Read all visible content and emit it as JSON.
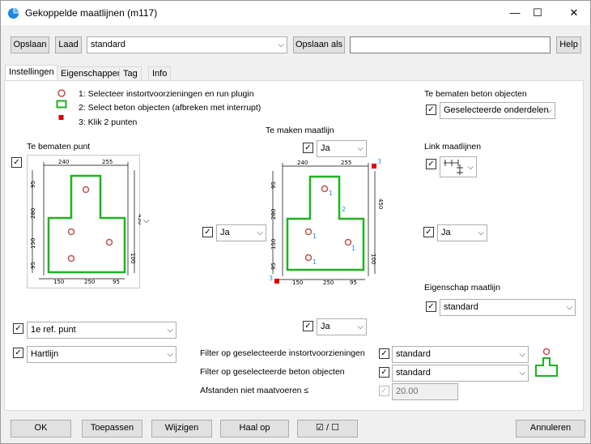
{
  "window": {
    "title": "Gekoppelde maatlijnen (m117)",
    "minimize": "—",
    "maximize": "☐",
    "close": "✕"
  },
  "toolbar": {
    "save_label": "Opslaan",
    "load_label": "Laad",
    "preset_value": "standard",
    "save_as_label": "Opslaan als",
    "save_as_value": "",
    "help_label": "Help"
  },
  "tabs": [
    {
      "label": "Instellingen",
      "active": true
    },
    {
      "label": "Eigenschappen"
    },
    {
      "label": "Tag"
    },
    {
      "label": "Info"
    }
  ],
  "legend": [
    {
      "text": "1: Selecteer instortvoorzieningen en run plugin"
    },
    {
      "text": "2: Select beton objecten (afbreken met interrupt)"
    },
    {
      "text": "3: Klik 2 punten"
    }
  ],
  "left": {
    "point_label": "Te bematen punt",
    "point_checked": true,
    "ref_point_value": "1e ref. punt",
    "ref_checked": true,
    "line_value": "Hartlijn",
    "line_checked": true
  },
  "middle": {
    "dim_line_label": "Te maken maatlijn",
    "top_value": "Ja",
    "left_value": "Ja",
    "bottom_value": "Ja"
  },
  "right": {
    "objects_label": "Te bematen beton objecten",
    "objects_value": "Geselecteerde onderdelen",
    "link_label": "Link maatlijnen",
    "right_value": "Ja",
    "property_label": "Eigenschap maatlijn",
    "property_value": "standard"
  },
  "filters": {
    "embeds_label": "Filter op geselecteerde instortvoorzieningen",
    "embeds_value": "standard",
    "concrete_label": "Filter op geselecteerde beton objecten",
    "concrete_value": "standard",
    "distance_label": "Afstanden niet maatvoeren ≤",
    "distance_value": "20.00"
  },
  "drawing_left": {
    "top_dims": [
      "240",
      "255"
    ],
    "bottom_dims": [
      "150",
      "250",
      "95"
    ],
    "left_dims": [
      "95",
      "280",
      "150",
      "95"
    ],
    "right_dims": [
      "450",
      "100"
    ]
  },
  "drawing_mid": {
    "top_dims": [
      "240",
      "255"
    ],
    "bottom_dims": [
      "150",
      "250",
      "95"
    ],
    "left_dims": [
      "95",
      "280",
      "150",
      "95"
    ],
    "right_dims": [
      "450",
      "100"
    ],
    "markers": [
      "1",
      "1",
      "1",
      "1",
      "2",
      "3",
      "3"
    ]
  },
  "bottom_buttons": {
    "ok": "OK",
    "apply": "Toepassen",
    "modify": "Wijzigen",
    "get": "Haal op",
    "toggle": "☑ / ☐",
    "cancel": "Annuleren"
  },
  "colors": {
    "concrete": "#1fb21f",
    "embed": "#c0504d",
    "click_point": "#e00000",
    "marker_text": "#1a8fd8"
  }
}
